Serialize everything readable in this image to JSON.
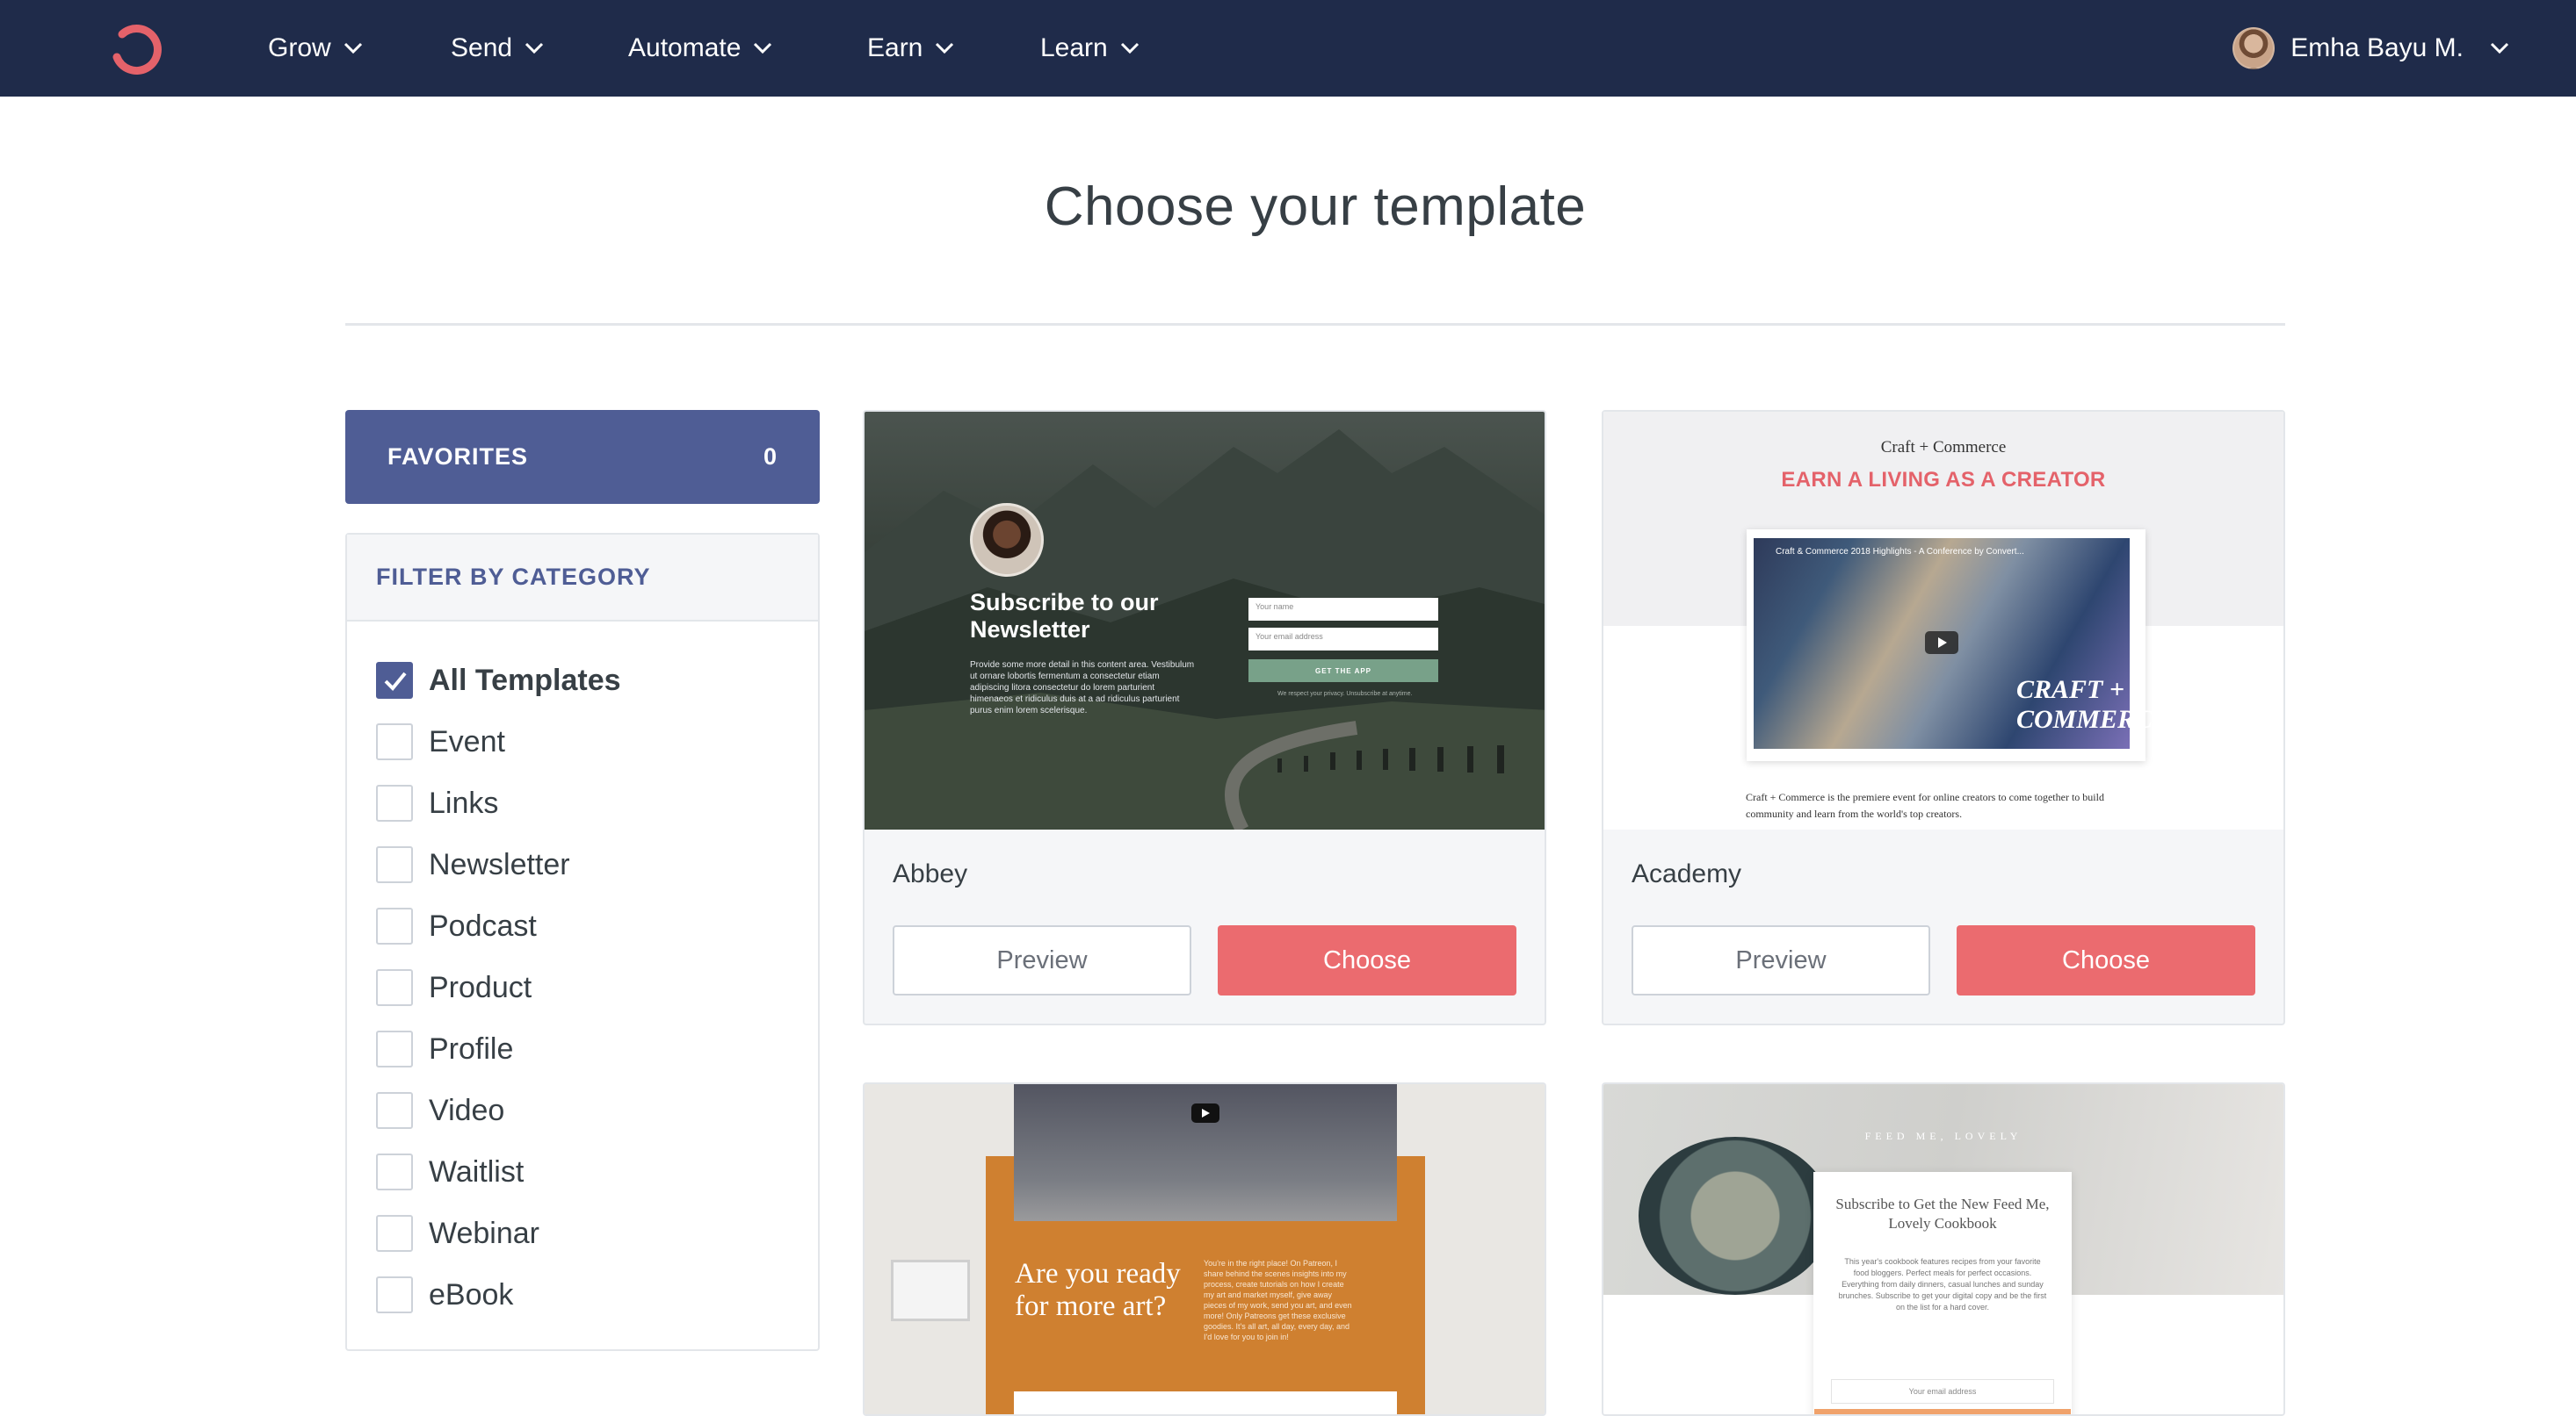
{
  "nav": {
    "items": [
      {
        "label": "Grow"
      },
      {
        "label": "Send"
      },
      {
        "label": "Automate"
      },
      {
        "label": "Earn"
      },
      {
        "label": "Learn"
      }
    ],
    "user_name": "Emha Bayu M."
  },
  "page": {
    "title": "Choose your template"
  },
  "sidebar": {
    "favorites_label": "FAVORITES",
    "favorites_count": "0",
    "filter_title": "FILTER BY CATEGORY",
    "categories": [
      {
        "label": "All Templates",
        "checked": true
      },
      {
        "label": "Event",
        "checked": false
      },
      {
        "label": "Links",
        "checked": false
      },
      {
        "label": "Newsletter",
        "checked": false
      },
      {
        "label": "Podcast",
        "checked": false
      },
      {
        "label": "Product",
        "checked": false
      },
      {
        "label": "Profile",
        "checked": false
      },
      {
        "label": "Video",
        "checked": false
      },
      {
        "label": "Waitlist",
        "checked": false
      },
      {
        "label": "Webinar",
        "checked": false
      },
      {
        "label": "eBook",
        "checked": false
      }
    ]
  },
  "templates": [
    {
      "name": "Abbey",
      "preview_label": "Preview",
      "choose_label": "Choose",
      "thumb": {
        "heading": "Subscribe to our Newsletter",
        "body": "Provide some more detail in this content area. Vestibulum ut ornare lobortis fermentum a consectetur etiam adipiscing litora consectetur do lorem parturient himenaeos et ridiculus duis at a ad ridiculus parturient purus enim lorem scelerisque.",
        "field_name": "Your name",
        "field_email": "Your email address",
        "button": "GET THE APP",
        "note": "We respect your privacy. Unsubscribe at anytime."
      }
    },
    {
      "name": "Academy",
      "preview_label": "Preview",
      "choose_label": "Choose",
      "thumb": {
        "kicker": "Craft + Commerce",
        "headline": "EARN A LIVING AS A CREATOR",
        "video_title": "Craft & Commerce 2018 Highlights - A Conference by Convert...",
        "overlay": "CRAFT + COMMERCE",
        "description": "Craft + Commerce is the premiere event for online creators to come together to build community and learn from the world's top creators."
      }
    },
    {
      "thumb": {
        "headline": "Are you ready for more art?",
        "body": "You're in the right place! On Patreon, I share behind the scenes insights into my process, create tutorials on how I create my art and market myself, give away pieces of my work, send you art, and even more! Only Patreons get these exclusive goodies. It's all art, all day, every day, and I'd love for you to join in!"
      }
    },
    {
      "thumb": {
        "kicker": "FEED ME, LOVELY",
        "headline": "Subscribe to Get the New Feed Me, Lovely Cookbook",
        "body": "This year's cookbook features recipes from your favorite food bloggers. Perfect meals for perfect occasions. Everything from daily dinners, casual lunches and sunday brunches. Subscribe to get your digital copy and be the first on the list for a hard cover.",
        "field": "Your email address"
      }
    }
  ],
  "colors": {
    "nav_bg": "#1f2b4a",
    "brand_accent": "#eb6b6f",
    "favorites_bg": "#4f5d95",
    "filter_text": "#4f5d95"
  },
  "icons": {
    "logo": "convertkit-logo-icon",
    "chevron": "chevron-down-icon",
    "check": "check-icon"
  }
}
